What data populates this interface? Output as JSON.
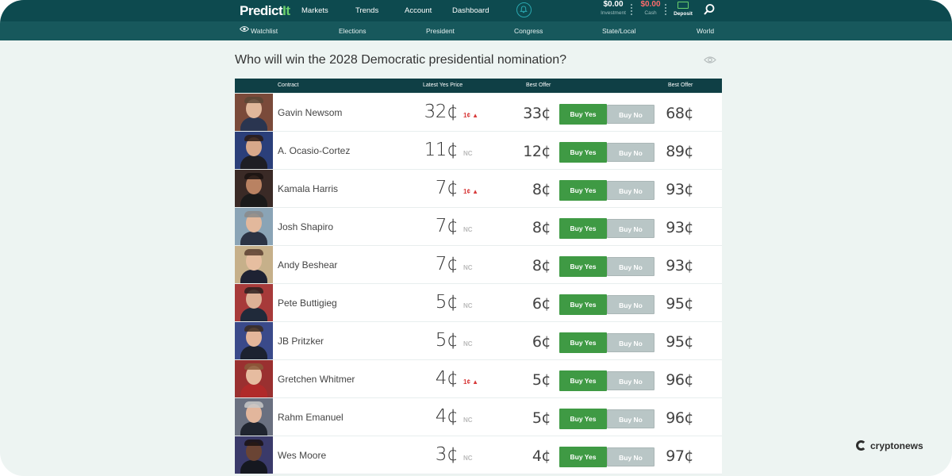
{
  "brand": {
    "name_main": "Predict",
    "name_accent": "It"
  },
  "nav": {
    "items": [
      "Markets",
      "Trends",
      "Account",
      "Dashboard"
    ]
  },
  "wallet": {
    "investment_amount": "$0.00",
    "investment_label": "Investment",
    "cash_amount": "$0.00",
    "cash_label": "Cash",
    "deposit_label": "Deposit"
  },
  "subnav": {
    "watchlist": "Watchlist",
    "items": [
      "Elections",
      "President",
      "Congress",
      "State/Local",
      "World"
    ]
  },
  "market": {
    "title": "Who will win the 2028 Democratic presidential nomination?",
    "columns": {
      "contract": "Contract",
      "latest_yes": "Latest Yes Price",
      "best_offer_yes": "Best Offer",
      "best_offer_no": "Best Offer"
    },
    "buy_yes_label": "Buy Yes",
    "buy_no_label": "Buy No",
    "contracts": [
      {
        "name": "Gavin Newsom",
        "price": "32¢",
        "change": "1¢",
        "change_dir": "up",
        "yes_offer": "33¢",
        "no_offer": "68¢"
      },
      {
        "name": "A. Ocasio-Cortez",
        "price": "11¢",
        "change": "NC",
        "change_dir": "nc",
        "yes_offer": "12¢",
        "no_offer": "89¢"
      },
      {
        "name": "Kamala Harris",
        "price": "7¢",
        "change": "1¢",
        "change_dir": "up",
        "yes_offer": "8¢",
        "no_offer": "93¢"
      },
      {
        "name": "Josh Shapiro",
        "price": "7¢",
        "change": "NC",
        "change_dir": "nc",
        "yes_offer": "8¢",
        "no_offer": "93¢"
      },
      {
        "name": "Andy Beshear",
        "price": "7¢",
        "change": "NC",
        "change_dir": "nc",
        "yes_offer": "8¢",
        "no_offer": "93¢"
      },
      {
        "name": "Pete Buttigieg",
        "price": "5¢",
        "change": "NC",
        "change_dir": "nc",
        "yes_offer": "6¢",
        "no_offer": "95¢"
      },
      {
        "name": "JB Pritzker",
        "price": "5¢",
        "change": "NC",
        "change_dir": "nc",
        "yes_offer": "6¢",
        "no_offer": "95¢"
      },
      {
        "name": "Gretchen Whitmer",
        "price": "4¢",
        "change": "1¢",
        "change_dir": "up",
        "yes_offer": "5¢",
        "no_offer": "96¢"
      },
      {
        "name": "Rahm Emanuel",
        "price": "4¢",
        "change": "NC",
        "change_dir": "nc",
        "yes_offer": "5¢",
        "no_offer": "96¢"
      },
      {
        "name": "Wes Moore",
        "price": "3¢",
        "change": "NC",
        "change_dir": "nc",
        "yes_offer": "4¢",
        "no_offer": "97¢"
      }
    ]
  },
  "watermark": "cryptonews",
  "colors": {
    "nav_bg": "#0d4a4f",
    "subnav_bg": "#17585c",
    "buy_yes": "#3f9a44",
    "buy_no": "#b9c6c6",
    "change_up": "#d83a3a"
  }
}
